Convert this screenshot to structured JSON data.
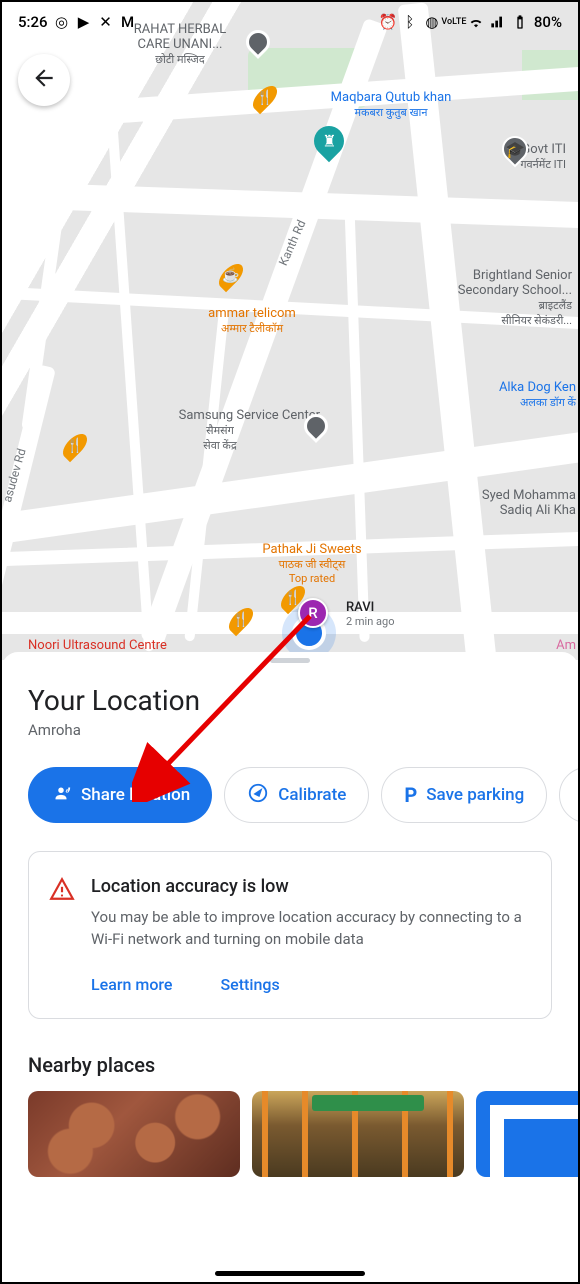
{
  "status": {
    "time": "5:26",
    "battery": "80%"
  },
  "map": {
    "labels": {
      "rahat": {
        "line1": "RAHAT HERBAL",
        "line2": "CARE UNANI...",
        "line3": "छोटी मस्जिद"
      },
      "maqbara": {
        "line1": "Maqbara Qutub khan",
        "line2": "मकबरा कुतुब खान"
      },
      "govt_iti": {
        "line1": "Govt ITI",
        "line2": "गवर्नमेंट ITI"
      },
      "brightland": {
        "line1": "Brightland Senior",
        "line2": "Secondary School...",
        "line3": "ब्राइटलैंड",
        "line4": "सीनियर सेकंडरी..."
      },
      "ammar": {
        "line1": "ammar telicom",
        "line2": "अम्मार टैलीकॉम"
      },
      "alka": {
        "line1": "Alka Dog Ken",
        "line2": "अलका डॉग कें"
      },
      "samsung": {
        "line1": "Samsung Service Center",
        "line2": "सैमसंग",
        "line3": "सेवा केंद्र"
      },
      "syed": {
        "line1": "Syed Mohamma",
        "line2": "Sadiq Ali Kha"
      },
      "pathak": {
        "line1": "Pathak Ji Sweets",
        "line2": "पाठक जी स्वीट्स",
        "line3": "Top rated"
      },
      "noori": "Noori Ultrasound Centre",
      "am": "Am",
      "road_kanth": "Kanth Rd",
      "road_asudev": "asudev Rd"
    },
    "user": {
      "initial": "R",
      "name": "RAVI",
      "ago": "2 min ago"
    }
  },
  "sheet": {
    "title": "Your Location",
    "subtitle": "Amroha",
    "chips": {
      "share": "Share location",
      "calibrate": "Calibrate",
      "save_parking": "Save parking"
    },
    "card": {
      "title": "Location accuracy is low",
      "text": "You may be able to improve location accuracy by connecting to a Wi-Fi network and turning on mobile data",
      "learn_more": "Learn more",
      "settings": "Settings"
    },
    "nearby_title": "Nearby places"
  }
}
